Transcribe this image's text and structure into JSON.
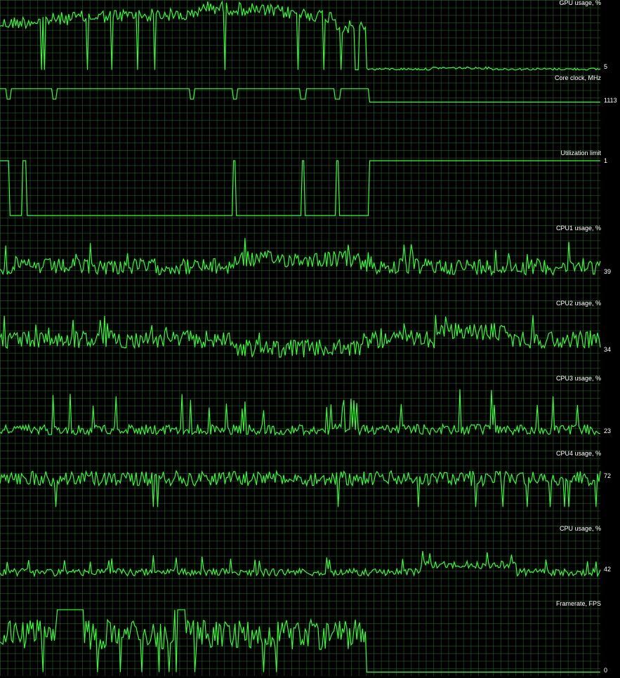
{
  "window": {
    "background": "#000000",
    "grid_color": "#286e28",
    "line_color": "#33ff33"
  },
  "graphs": [
    {
      "id": "gpu-usage",
      "title": "GPU usage, %",
      "current": "5",
      "shape": "gpu"
    },
    {
      "id": "core-clock",
      "title": "Core clock, MHz",
      "current": "1113",
      "shape": "clock"
    },
    {
      "id": "utilization-limit",
      "title": "Utilization limit",
      "current": "1",
      "shape": "limit"
    },
    {
      "id": "cpu1-usage",
      "title": "CPU1 usage, %",
      "current": "39",
      "shape": "cpu1"
    },
    {
      "id": "cpu2-usage",
      "title": "CPU2 usage, %",
      "current": "34",
      "shape": "cpu2"
    },
    {
      "id": "cpu3-usage",
      "title": "CPU3 usage, %",
      "current": "23",
      "shape": "cpu3"
    },
    {
      "id": "cpu4-usage",
      "title": "CPU4 usage, %",
      "current": "72",
      "shape": "cpu4"
    },
    {
      "id": "cpu-usage",
      "title": "CPU usage, %",
      "current": "42",
      "shape": "cpu"
    },
    {
      "id": "framerate",
      "title": "Framerate, FPS",
      "current": "0",
      "shape": "fps"
    }
  ]
}
